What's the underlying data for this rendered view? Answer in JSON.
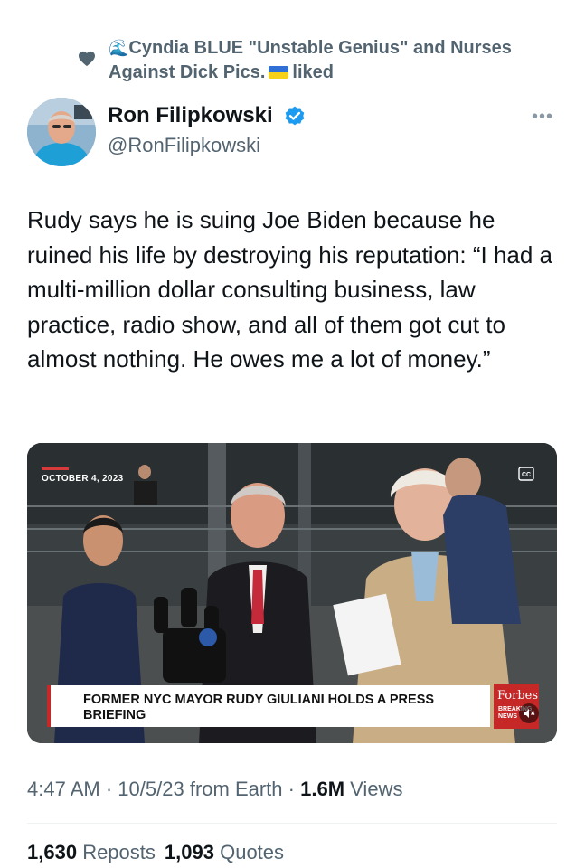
{
  "social_context": {
    "liker_name": "Cyndia BLUE \"Unstable Genius\" and Nurses Against Dick Pics.",
    "liked_label": "liked",
    "icon": "heart-icon",
    "emojis": [
      "water-wave-emoji",
      "ukraine-flag-emoji"
    ]
  },
  "author": {
    "display_name": "Ron Filipkowski",
    "handle": "@RonFilipkowski",
    "verified": true,
    "badge_color": "#1d9bf0"
  },
  "tweet": {
    "text": "Rudy says he is suing Joe Biden because he ruined his life by destroying his reputation: “I had a multi-million dollar consulting business, law practice, radio show, and all of them got cut to almost nothing. He owes me a lot of money.”"
  },
  "media": {
    "date_tag": "OCTOBER 4, 2023",
    "headline": "FORMER NYC MAYOR RUDY GIULIANI HOLDS A PRESS BRIEFING",
    "brand": "Forbes",
    "brand_sub": "BREAKING NEWS",
    "captions_icon": "captions-icon",
    "mute_icon": "speaker-muted-icon"
  },
  "meta": {
    "time": "4:47 AM",
    "separator": "·",
    "date": "10/5/23",
    "source": "from Earth",
    "views_count": "1.6M",
    "views_label": "Views"
  },
  "stats": {
    "reposts_count": "1,630",
    "reposts_label": "Reposts",
    "quotes_count": "1,093",
    "quotes_label": "Quotes"
  },
  "colors": {
    "text_primary": "#0f1419",
    "text_secondary": "#536471",
    "divider": "#eff3f4",
    "brand_red": "#c62828"
  }
}
